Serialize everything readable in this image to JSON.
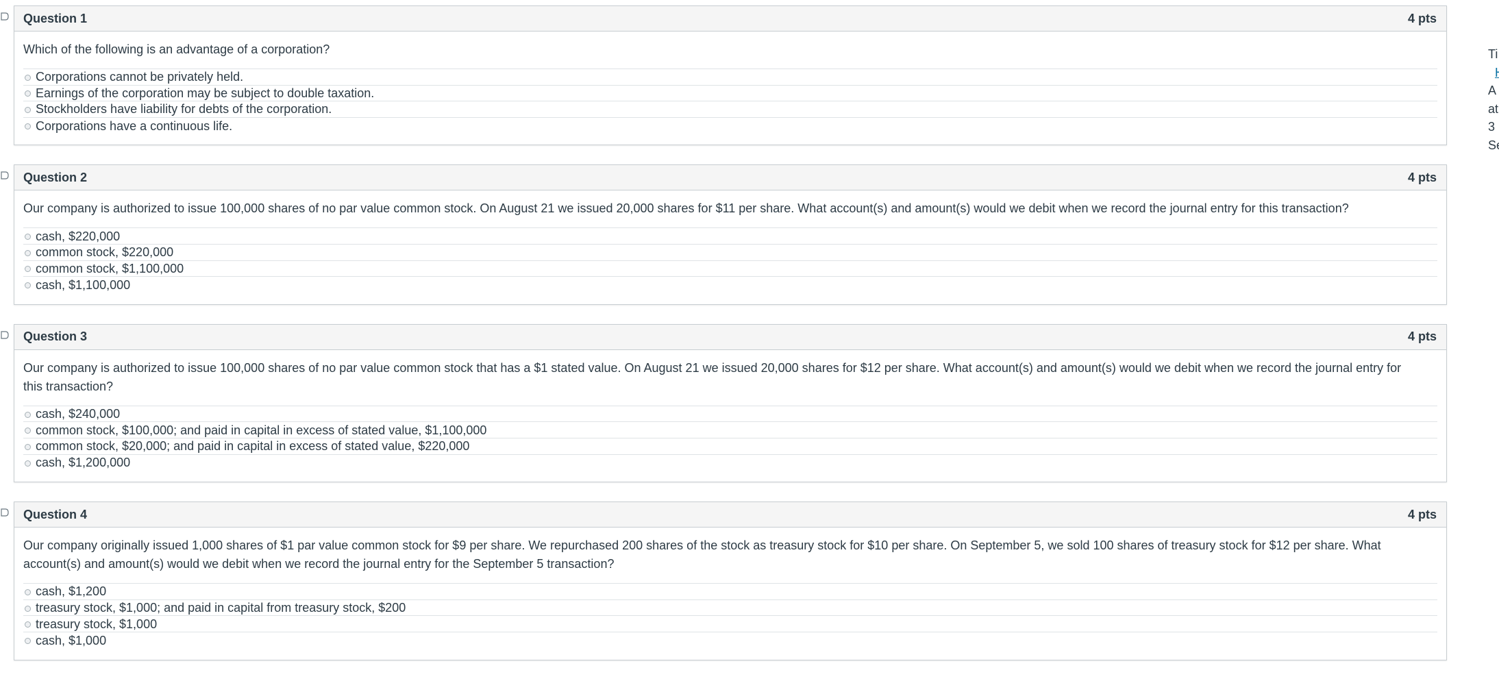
{
  "questions": [
    {
      "name": "Question 1",
      "points": "4 pts",
      "text": "Which of the following is an advantage of a corporation?",
      "answers": [
        "Corporations cannot be privately held.",
        "Earnings of the corporation may be subject to double taxation.",
        "Stockholders have liability for debts of the corporation.",
        "Corporations have a continuous life."
      ]
    },
    {
      "name": "Question 2",
      "points": "4 pts",
      "text": "Our company is authorized to issue 100,000 shares of no par value common stock. On August 21 we issued 20,000 shares for $11 per share. What account(s) and amount(s) would we debit when we record the journal entry for this transaction?",
      "answers": [
        "cash, $220,000",
        "common stock, $220,000",
        "common stock, $1,100,000",
        "cash, $1,100,000"
      ]
    },
    {
      "name": "Question 3",
      "points": "4 pts",
      "text": "Our company is authorized to issue 100,000 shares of no par value common stock that has a $1 stated value. On August 21 we issued 20,000 shares for $12 per share. What account(s) and amount(s) would we debit when we record the journal entry for this transaction?",
      "answers": [
        "cash, $240,000",
        "common stock, $100,000; and paid in capital in excess of stated value, $1,100,000",
        "common stock, $20,000; and paid in capital in excess of stated value, $220,000",
        "cash, $1,200,000"
      ]
    },
    {
      "name": "Question 4",
      "points": "4 pts",
      "text": "Our company originally issued 1,000 shares of $1 par value common stock for $9 per share. We repurchased 200 shares of the stock as treasury stock for $10 per share. On September 5, we sold 100 shares of treasury stock for $12 per share. What account(s) and amount(s) would we debit when we record the journal entry for the September 5 transaction?",
      "answers": [
        "cash, $1,200",
        "treasury stock, $1,000; and paid in capital from treasury stock, $200",
        "treasury stock, $1,000",
        "cash, $1,000"
      ]
    }
  ],
  "sidebar": {
    "lines": [
      "Ti",
      "H",
      "A",
      "at",
      "3",
      "Se"
    ]
  },
  "colors": {
    "header_bg": "#f5f5f5",
    "border": "#c7cdd1",
    "text": "#2d3b45",
    "link": "#0770a3"
  },
  "icons": {
    "flag": "flag-outline-icon",
    "radio": "radio-unselected"
  }
}
